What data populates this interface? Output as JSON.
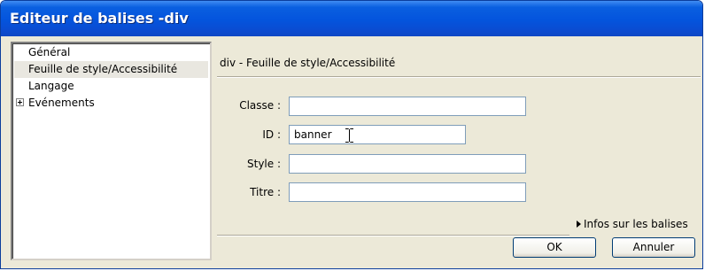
{
  "window": {
    "title": "Editeur de balises -div"
  },
  "tree": {
    "items": [
      {
        "label": "Général",
        "expandable": false,
        "selected": false
      },
      {
        "label": "Feuille de style/Accessibilité",
        "expandable": false,
        "selected": true
      },
      {
        "label": "Langage",
        "expandable": false,
        "selected": false
      },
      {
        "label": "Evénements",
        "expandable": true,
        "selected": false
      }
    ]
  },
  "panel": {
    "title": "div - Feuille de style/Accessibilité",
    "fields": {
      "classe": {
        "label": "Classe :",
        "value": ""
      },
      "id": {
        "label": "ID :",
        "value": "banner"
      },
      "style": {
        "label": "Style :",
        "value": ""
      },
      "titre": {
        "label": "Titre :",
        "value": ""
      }
    },
    "infos_label": "Infos sur les balises"
  },
  "buttons": {
    "ok": "OK",
    "cancel": "Annuler"
  }
}
